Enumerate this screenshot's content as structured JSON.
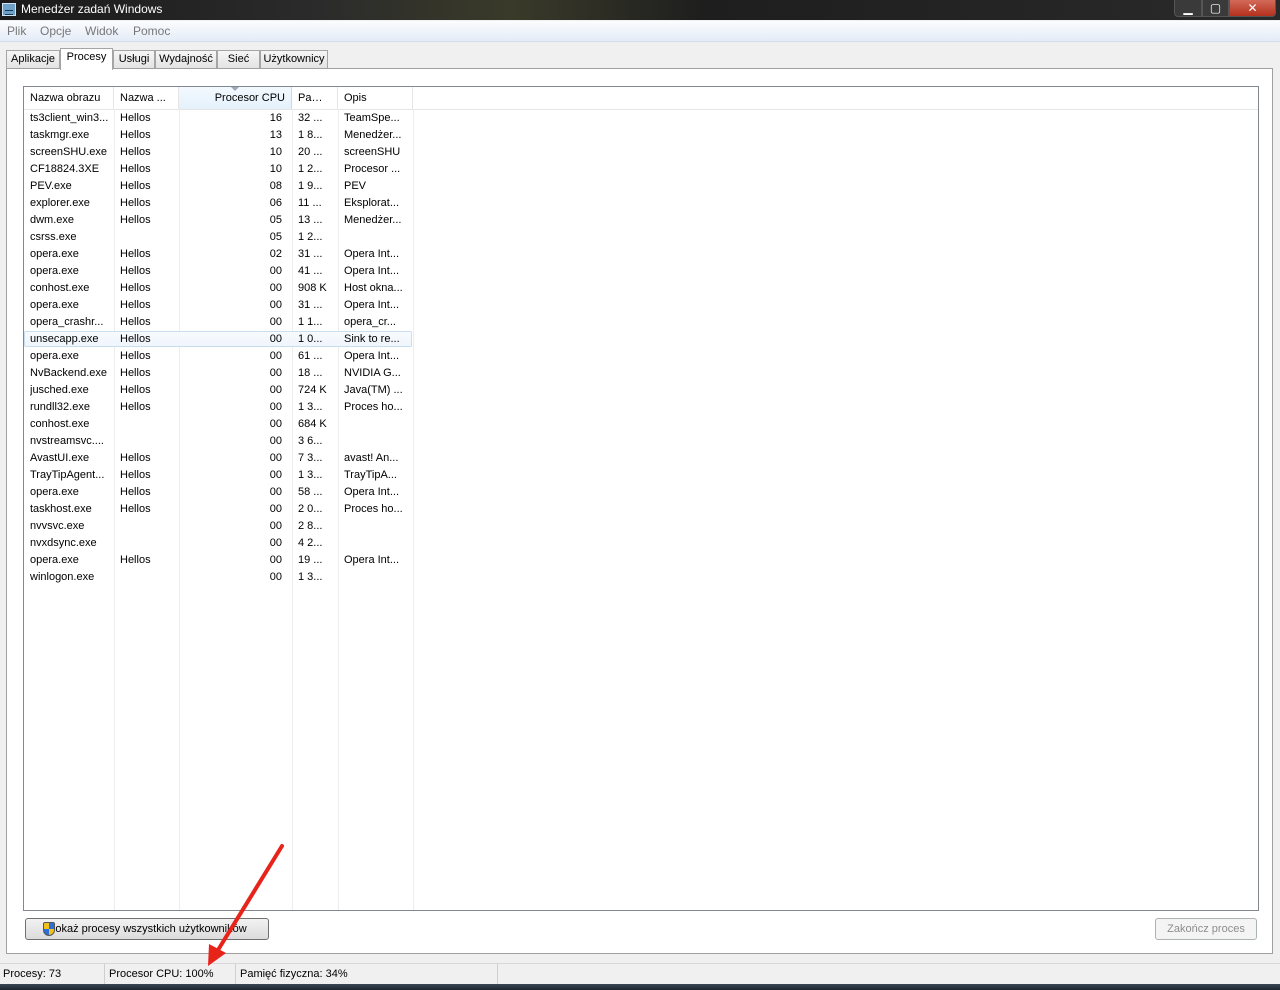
{
  "window": {
    "title": "Menedżer zadań Windows"
  },
  "menu": [
    "Plik",
    "Opcje",
    "Widok",
    "Pomoc"
  ],
  "tabs": [
    "Aplikacje",
    "Procesy",
    "Usługi",
    "Wydajność",
    "Sieć",
    "Użytkownicy"
  ],
  "active_tab": "Procesy",
  "columns": {
    "name": "Nazwa obrazu",
    "user": "Nazwa ...",
    "cpu": "Procesor CPU",
    "mem": "Pami...",
    "desc": "Opis"
  },
  "processes": [
    {
      "name": "ts3client_win3...",
      "user": "Hellos",
      "cpu": "16",
      "mem": "32 ...",
      "desc": "TeamSpe..."
    },
    {
      "name": "taskmgr.exe",
      "user": "Hellos",
      "cpu": "13",
      "mem": "1 8...",
      "desc": "Menedżer..."
    },
    {
      "name": "screenSHU.exe",
      "user": "Hellos",
      "cpu": "10",
      "mem": "20 ...",
      "desc": "screenSHU"
    },
    {
      "name": "CF18824.3XE",
      "user": "Hellos",
      "cpu": "10",
      "mem": "1 2...",
      "desc": "Procesor ..."
    },
    {
      "name": "PEV.exe",
      "user": "Hellos",
      "cpu": "08",
      "mem": "1 9...",
      "desc": "PEV"
    },
    {
      "name": "explorer.exe",
      "user": "Hellos",
      "cpu": "06",
      "mem": "11 ...",
      "desc": "Eksplorat..."
    },
    {
      "name": "dwm.exe",
      "user": "Hellos",
      "cpu": "05",
      "mem": "13 ...",
      "desc": "Menedżer..."
    },
    {
      "name": "csrss.exe",
      "user": "",
      "cpu": "05",
      "mem": "1 2...",
      "desc": ""
    },
    {
      "name": "opera.exe",
      "user": "Hellos",
      "cpu": "02",
      "mem": "31 ...",
      "desc": "Opera Int..."
    },
    {
      "name": "opera.exe",
      "user": "Hellos",
      "cpu": "00",
      "mem": "41 ...",
      "desc": "Opera Int..."
    },
    {
      "name": "conhost.exe",
      "user": "Hellos",
      "cpu": "00",
      "mem": "908 K",
      "desc": "Host okna..."
    },
    {
      "name": "opera.exe",
      "user": "Hellos",
      "cpu": "00",
      "mem": "31 ...",
      "desc": "Opera Int..."
    },
    {
      "name": "opera_crashr...",
      "user": "Hellos",
      "cpu": "00",
      "mem": "1 1...",
      "desc": "opera_cr..."
    },
    {
      "name": "unsecapp.exe",
      "user": "Hellos",
      "cpu": "00",
      "mem": "1 0...",
      "desc": "Sink to re..."
    },
    {
      "name": "opera.exe",
      "user": "Hellos",
      "cpu": "00",
      "mem": "61 ...",
      "desc": "Opera Int..."
    },
    {
      "name": "NvBackend.exe",
      "user": "Hellos",
      "cpu": "00",
      "mem": "18 ...",
      "desc": "NVIDIA G..."
    },
    {
      "name": "jusched.exe",
      "user": "Hellos",
      "cpu": "00",
      "mem": "724 K",
      "desc": "Java(TM) ..."
    },
    {
      "name": "rundll32.exe",
      "user": "Hellos",
      "cpu": "00",
      "mem": "1 3...",
      "desc": "Proces ho..."
    },
    {
      "name": "conhost.exe",
      "user": "",
      "cpu": "00",
      "mem": "684 K",
      "desc": ""
    },
    {
      "name": "nvstreamsvc....",
      "user": "",
      "cpu": "00",
      "mem": "3 6...",
      "desc": ""
    },
    {
      "name": "AvastUI.exe",
      "user": "Hellos",
      "cpu": "00",
      "mem": "7 3...",
      "desc": "avast! An..."
    },
    {
      "name": "TrayTipAgent...",
      "user": "Hellos",
      "cpu": "00",
      "mem": "1 3...",
      "desc": "TrayTipA..."
    },
    {
      "name": "opera.exe",
      "user": "Hellos",
      "cpu": "00",
      "mem": "58 ...",
      "desc": "Opera Int..."
    },
    {
      "name": "taskhost.exe",
      "user": "Hellos",
      "cpu": "00",
      "mem": "2 0...",
      "desc": "Proces ho..."
    },
    {
      "name": "nvvsvc.exe",
      "user": "",
      "cpu": "00",
      "mem": "2 8...",
      "desc": ""
    },
    {
      "name": "nvxdsync.exe",
      "user": "",
      "cpu": "00",
      "mem": "4 2...",
      "desc": ""
    },
    {
      "name": "opera.exe",
      "user": "Hellos",
      "cpu": "00",
      "mem": "19 ...",
      "desc": "Opera Int..."
    },
    {
      "name": "winlogon.exe",
      "user": "",
      "cpu": "00",
      "mem": "1 3...",
      "desc": ""
    }
  ],
  "selected_process": "unsecapp.exe",
  "buttons": {
    "show_all": "Pokaż procesy wszystkich użytkowników",
    "end_process": "Zakończ proces"
  },
  "status": {
    "processes": "Procesy: 73",
    "cpu": "Procesor CPU: 100%",
    "memory": "Pamięć fizyczna: 34%"
  },
  "annotation_color": "#e8231a"
}
